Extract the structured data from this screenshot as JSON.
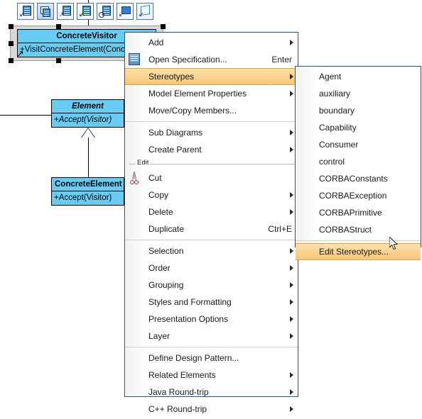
{
  "diagram": {
    "toolbar": {
      "buttons": [
        {
          "name": "create-class-with-arrow-icon",
          "glyph": "class-arrow"
        },
        {
          "name": "create-package-icon",
          "glyph": "package",
          "selected": true
        },
        {
          "name": "create-class-up-right-icon",
          "glyph": "class-up-right"
        },
        {
          "name": "create-class-down-left-icon",
          "glyph": "class-down-left"
        },
        {
          "name": "create-class-forbidden-icon",
          "glyph": "class-forbidden"
        },
        {
          "name": "create-note-icon",
          "glyph": "note"
        },
        {
          "name": "create-component-icon",
          "glyph": "component"
        }
      ]
    },
    "classes": [
      {
        "name": "ConcreteVisitor",
        "abstract": false,
        "operations": [
          "+VisitConcreteElement(Concre"
        ],
        "selected": true
      },
      {
        "name": "Element",
        "abstract": true,
        "operations": [
          "+Accept(Visitor)"
        ],
        "selected": false
      },
      {
        "name": "ConcreteElement",
        "abstract": false,
        "operations": [
          "+Accept(Visitor)"
        ],
        "selected": false
      }
    ]
  },
  "context_menu": {
    "groups": [
      {
        "separator": null,
        "items": [
          {
            "label": "Add",
            "submenu": true,
            "accel": "",
            "icon": null
          },
          {
            "label": "Open Specification...",
            "submenu": false,
            "accel": "Enter",
            "icon": "specification-icon"
          },
          {
            "label": "Stereotypes",
            "submenu": true,
            "accel": "",
            "icon": null,
            "highlighted": true
          },
          {
            "label": "Model Element Properties",
            "submenu": true,
            "accel": "",
            "icon": null
          },
          {
            "label": "Move/Copy Members...",
            "submenu": false,
            "accel": "",
            "icon": null
          }
        ]
      },
      {
        "separator": "",
        "items": [
          {
            "label": "Sub Diagrams",
            "submenu": true,
            "accel": "",
            "icon": null
          },
          {
            "label": "Create Parent",
            "submenu": true,
            "accel": "",
            "icon": null
          }
        ]
      },
      {
        "separator": "Edit",
        "items": [
          {
            "label": "Cut",
            "submenu": false,
            "accel": "",
            "icon": "scissors-icon"
          },
          {
            "label": "Copy",
            "submenu": true,
            "accel": "",
            "icon": null
          },
          {
            "label": "Delete",
            "submenu": true,
            "accel": "",
            "icon": null
          },
          {
            "label": "Duplicate",
            "submenu": false,
            "accel": "Ctrl+E",
            "icon": null
          }
        ]
      },
      {
        "separator": "",
        "items": [
          {
            "label": "Selection",
            "submenu": true,
            "accel": "",
            "icon": null
          },
          {
            "label": "Order",
            "submenu": true,
            "accel": "",
            "icon": null
          },
          {
            "label": "Grouping",
            "submenu": true,
            "accel": "",
            "icon": null
          },
          {
            "label": "Styles and Formatting",
            "submenu": true,
            "accel": "",
            "icon": null
          },
          {
            "label": "Presentation Options",
            "submenu": true,
            "accel": "",
            "icon": null
          },
          {
            "label": "Layer",
            "submenu": true,
            "accel": "",
            "icon": null
          }
        ]
      },
      {
        "separator": "",
        "items": [
          {
            "label": "Define Design Pattern...",
            "submenu": false,
            "accel": "",
            "icon": null
          },
          {
            "label": "Related Elements",
            "submenu": true,
            "accel": "",
            "icon": null
          },
          {
            "label": "Java Round-trip",
            "submenu": true,
            "accel": "",
            "icon": null
          },
          {
            "label": "C++ Round-trip",
            "submenu": true,
            "accel": "",
            "icon": null
          }
        ]
      }
    ]
  },
  "stereotypes_submenu": {
    "items": [
      {
        "label": "Agent",
        "highlighted": false
      },
      {
        "label": "auxiliary",
        "highlighted": false
      },
      {
        "label": "boundary",
        "highlighted": false
      },
      {
        "label": "Capability",
        "highlighted": false
      },
      {
        "label": "Consumer",
        "highlighted": false
      },
      {
        "label": "control",
        "highlighted": false
      },
      {
        "label": "CORBAConstants",
        "highlighted": false
      },
      {
        "label": "CORBAException",
        "highlighted": false
      },
      {
        "label": "CORBAPrimitive",
        "highlighted": false
      },
      {
        "label": "CORBAStruct",
        "highlighted": false
      }
    ],
    "action": {
      "label": "Edit Stereotypes...",
      "highlighted": true
    }
  },
  "colors": {
    "class_fill": "#66ccf2",
    "highlight": "#f7c677",
    "menu_border": "#2b4d80"
  }
}
